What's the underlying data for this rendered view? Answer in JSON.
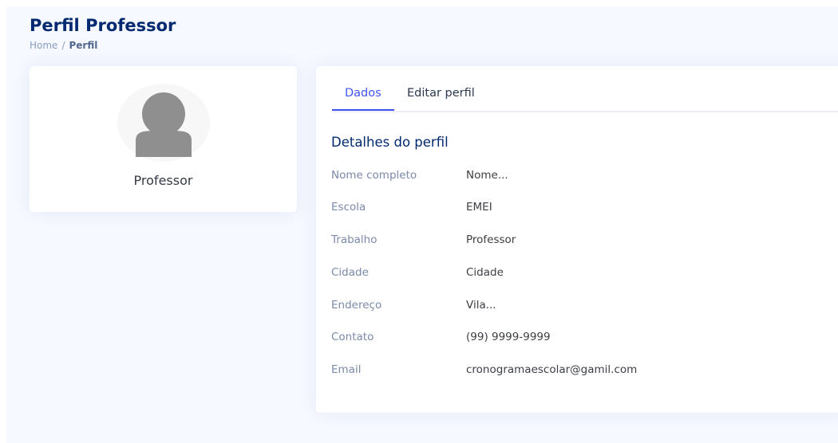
{
  "header": {
    "title": "Perfil Professor",
    "breadcrumb": [
      "Home",
      "/",
      "Perfil"
    ]
  },
  "profile_card": {
    "avatar_icon": "user-avatar-icon",
    "name": "Professor"
  },
  "tabs": [
    {
      "label": "Dados",
      "active": true
    },
    {
      "label": "Editar perfil",
      "active": false
    }
  ],
  "details": {
    "title": "Detalhes do perfil",
    "rows": [
      {
        "label": "Nome completo",
        "value": "Nome..."
      },
      {
        "label": "Escola",
        "value": "EMEI"
      },
      {
        "label": "Trabalho",
        "value": "Professor"
      },
      {
        "label": "Cidade",
        "value": "Cidade"
      },
      {
        "label": "Endereço",
        "value": "Vila..."
      },
      {
        "label": "Contato",
        "value": "(99) 9999-9999"
      },
      {
        "label": "Email",
        "value": "cronogramaescolar@gamil.com"
      }
    ]
  },
  "colors": {
    "background": "#f6f9ff",
    "title": "#012970",
    "accent": "#4154f1"
  }
}
